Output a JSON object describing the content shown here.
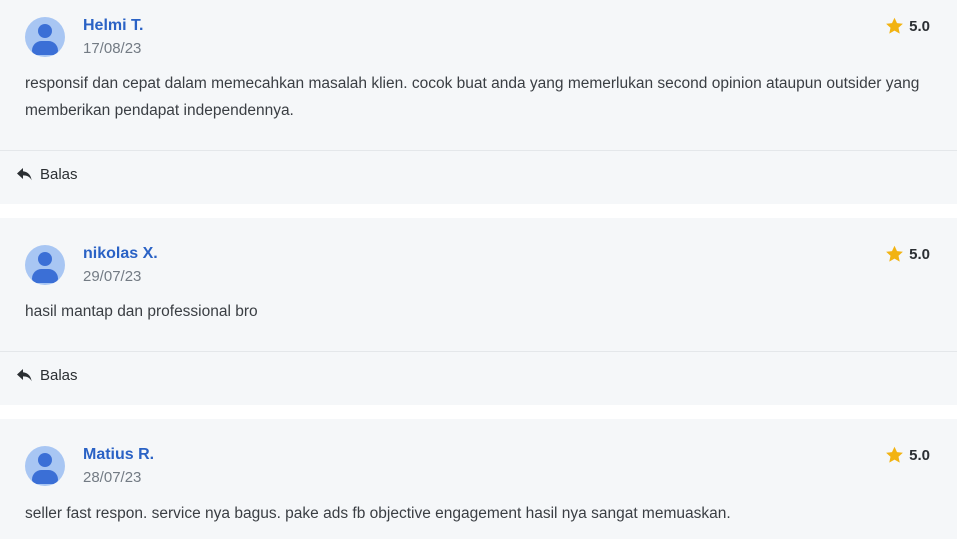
{
  "reviews": [
    {
      "name": "Helmi T.",
      "date": "17/08/23",
      "rating": "5.0",
      "comment": "responsif dan cepat dalam memecahkan masalah klien. cocok buat anda yang memerlukan second opinion ataupun outsider yang memberikan pendapat independennya.",
      "reply_label": "Balas"
    },
    {
      "name": "nikolas X.",
      "date": "29/07/23",
      "rating": "5.0",
      "comment": "hasil mantap dan professional bro",
      "reply_label": "Balas"
    },
    {
      "name": "Matius R.",
      "date": "28/07/23",
      "rating": "5.0",
      "comment": "seller fast respon. service nya bagus. pake ads fb objective engagement hasil nya sangat memuaskan."
    }
  ],
  "icons": {
    "avatar": "user-avatar-icon",
    "rating": "star-icon",
    "reply": "reply-arrow-icon"
  },
  "colors": {
    "accent": "#2a62c5",
    "star": "#f2b312",
    "card_bg": "#f5f7f9",
    "avatar_bg": "#a8c6f3"
  }
}
